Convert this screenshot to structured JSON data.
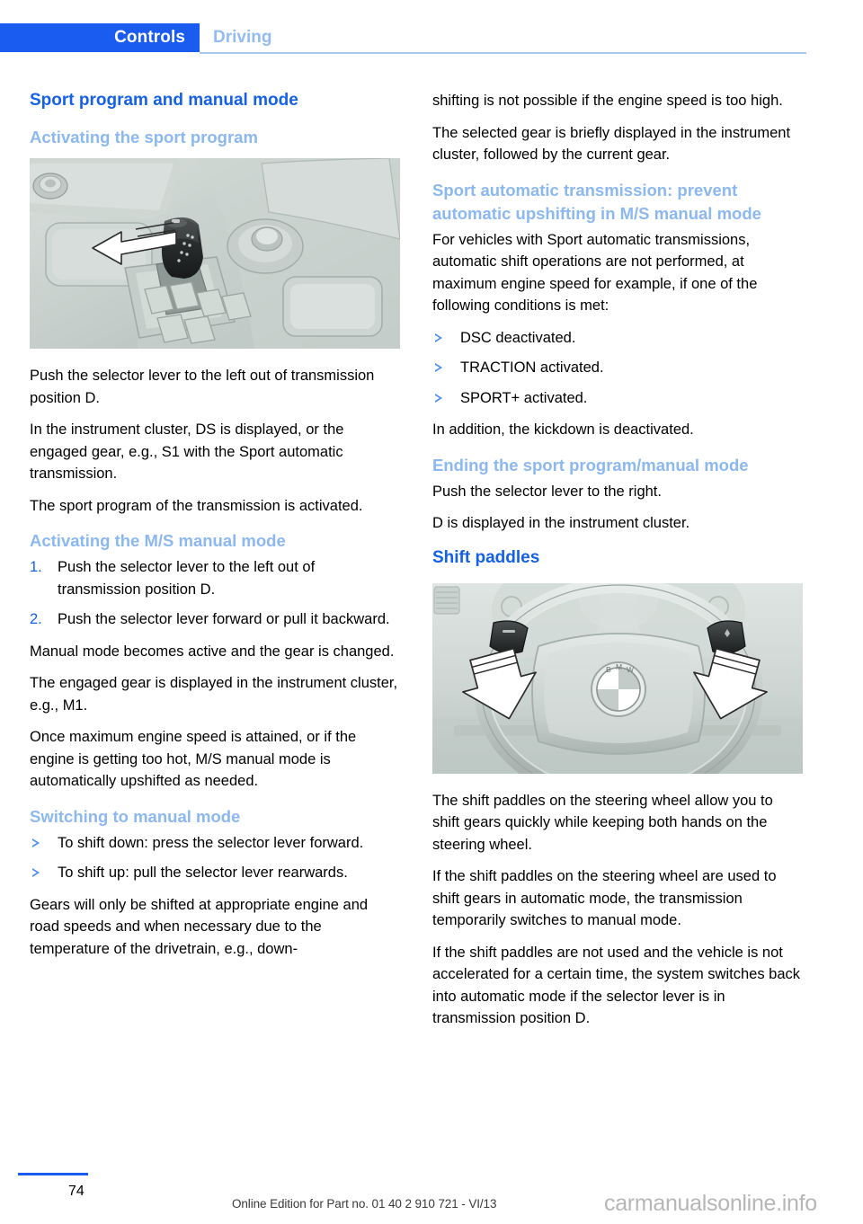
{
  "header": {
    "active_tab": "Controls",
    "inactive_tab": "Driving",
    "accent_color": "#1a5cf0",
    "inactive_color": "#93bcf7"
  },
  "left_column": {
    "title": "Sport program and manual mode",
    "section_1": {
      "heading": "Activating the sport program",
      "figure_alt": "center-console-selector-lever-illustration",
      "paragraphs": [
        "Push the selector lever to the left out of transmission position D.",
        "In the instrument cluster, DS is displayed, or the engaged gear, e.g., S1 with the Sport automatic transmission.",
        "The sport program of the transmission is activated."
      ]
    },
    "section_2": {
      "heading": "Activating the M/S manual mode",
      "steps": [
        {
          "marker": "1.",
          "text": "Push the selector lever to the left out of transmission position D."
        },
        {
          "marker": "2.",
          "text": "Push the selector lever forward or pull it backward."
        }
      ],
      "paragraphs": [
        "Manual mode becomes active and the gear is changed.",
        "The engaged gear is displayed in the instrument cluster, e.g., M1.",
        "Once maximum engine speed is attained, or if the engine is getting too hot, M/S manual mode is automatically upshifted as needed."
      ]
    },
    "section_3": {
      "heading": "Switching to manual mode",
      "bullets": [
        "To shift down: press the selector lever forward.",
        "To shift up: pull the selector lever rearwards."
      ],
      "paragraphs": [
        "Gears will only be shifted at appropriate engine and road speeds and when necessary due to the temperature of the drivetrain, e.g., down-"
      ]
    }
  },
  "right_column": {
    "continued_paragraphs": [
      "shifting is not possible if the engine speed is too high.",
      "The selected gear is briefly displayed in the instrument cluster, followed by the current gear."
    ],
    "section_4": {
      "heading": "Sport automatic transmission: prevent automatic upshifting in M/S manual mode",
      "intro": "For vehicles with Sport automatic transmissions, automatic shift operations are not performed, at maximum engine speed for example, if one of the following conditions is met:",
      "bullets": [
        "DSC deactivated.",
        "TRACTION activated.",
        "SPORT+ activated."
      ],
      "outro": "In addition, the kickdown is deactivated."
    },
    "section_5": {
      "heading": "Ending the sport program/manual mode",
      "paragraphs": [
        "Push the selector lever to the right.",
        "D is displayed in the instrument cluster."
      ]
    },
    "section_6": {
      "title": "Shift paddles",
      "figure_alt": "steering-wheel-shift-paddles-illustration",
      "paragraphs": [
        "The shift paddles on the steering wheel allow you to shift gears quickly while keeping both hands on the steering wheel.",
        "If the shift paddles on the steering wheel are used to shift gears in automatic mode, the transmission temporarily switches to manual mode.",
        "If the shift paddles are not used and the vehicle is not accelerated for a certain time, the system switches back into automatic mode if the selector lever is in transmission position D."
      ]
    }
  },
  "footer": {
    "page_number": "74",
    "edition": "Online Edition for Part no. 01 40 2 910 721 - VI/13",
    "watermark": "carmanualsonline.info"
  }
}
